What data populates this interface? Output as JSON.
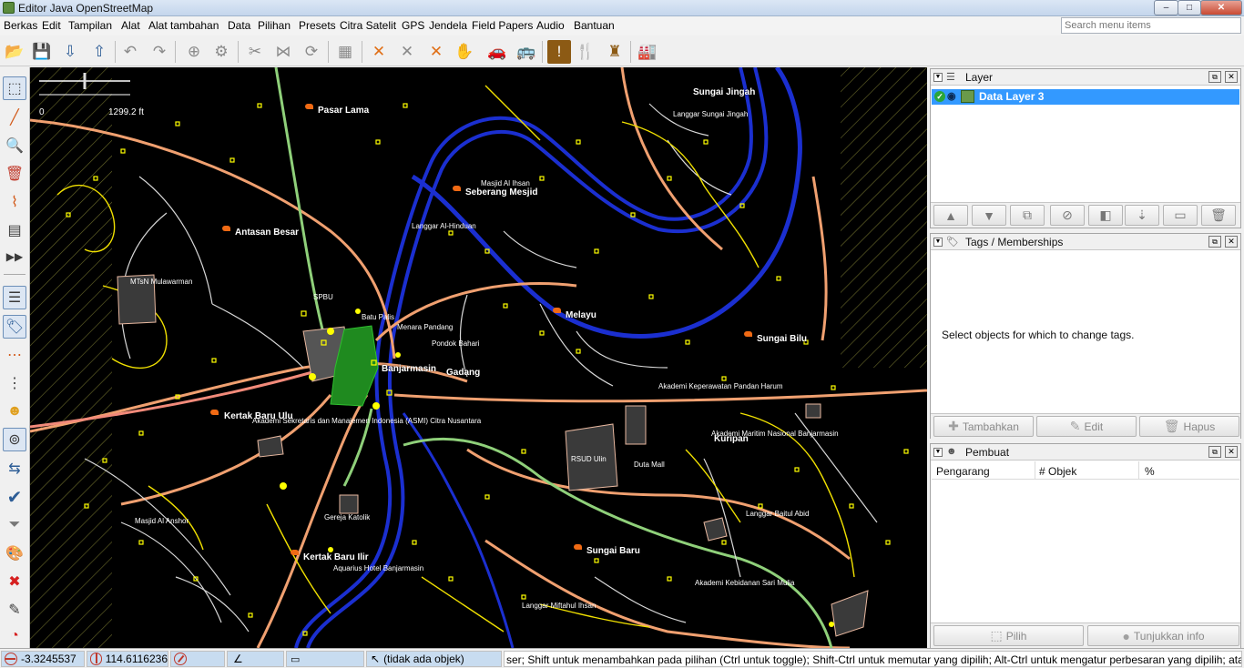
{
  "window": {
    "title": "Editor Java OpenStreetMap",
    "min": "–",
    "max": "□",
    "close": "✕"
  },
  "menu": {
    "items": [
      "Berkas",
      "Edit",
      "Tampilan",
      "Alat",
      "Alat tambahan",
      "Data",
      "Pilihan",
      "Presets",
      "Citra Satelit",
      "GPS",
      "Jendela",
      "Field Papers",
      "Audio",
      "Bantuan"
    ],
    "search_placeholder": "Search menu items"
  },
  "toolbar": {
    "icons": [
      "open-file-icon",
      "save-icon",
      "download-icon",
      "upload-icon",
      "undo-icon",
      "redo-icon",
      "zoom-to-data-icon",
      "preferences-icon",
      "split-way-icon",
      "combine-way-icon",
      "reverse-icon",
      "satellite-imagery-icon",
      "highway-icon",
      "highway-tertiary-icon",
      "highway-junction-icon",
      "barrier-hand-icon",
      "car-icon",
      "bus-icon",
      "amenity-icon",
      "restaurant-icon",
      "castle-icon",
      "industrial-icon"
    ]
  },
  "leftbar": {
    "icons": [
      "select-tool-icon",
      "draw-tool-icon",
      "zoom-tool-icon",
      "delete-tool-icon",
      "improve-way-icon",
      "parallel-way-icon",
      "more-tools-icon",
      "layers-toggle-icon",
      "tags-toggle-icon",
      "relations-toggle-icon",
      "selection-list-icon",
      "users-toggle-icon",
      "filter-toggle-icon",
      "conflict-toggle-icon",
      "validation-icon",
      "filter-icon",
      "map-paint-icon",
      "errors-icon",
      "history-icon",
      "speed-icon"
    ]
  },
  "map": {
    "scale": {
      "zero": "0",
      "max": "1299.2 ft"
    },
    "places": [
      {
        "name": "Pasar Lama",
        "kind": "place"
      },
      {
        "name": "Sungai Jingah",
        "kind": "place"
      },
      {
        "name": "Seberang Mesjid",
        "kind": "place"
      },
      {
        "name": "Antasan Besar",
        "kind": "place"
      },
      {
        "name": "Melayu",
        "kind": "place"
      },
      {
        "name": "Sungai Bilu",
        "kind": "place"
      },
      {
        "name": "Banjarmasin",
        "kind": "place"
      },
      {
        "name": "Gadang",
        "kind": "place"
      },
      {
        "name": "Kertak Baru Ulu",
        "kind": "place"
      },
      {
        "name": "Kuripan",
        "kind": "place"
      },
      {
        "name": "Kertak Baru Ilir",
        "kind": "place"
      },
      {
        "name": "Sungai Baru",
        "kind": "place"
      }
    ],
    "pois": [
      {
        "name": "Masjid Al Ihsan"
      },
      {
        "name": "Langgar Al-Hinduan"
      },
      {
        "name": "MTsN Mulawarman"
      },
      {
        "name": "SPBU"
      },
      {
        "name": "Batu Palis"
      },
      {
        "name": "Menara Pandang"
      },
      {
        "name": "Pondok Bahari"
      },
      {
        "name": "Akademi Keperawatan Pandan Harum"
      },
      {
        "name": "Akademi Sekretaris dan Manajemen Indonesia (ASMI) Citra Nusantara"
      },
      {
        "name": "RSUD Ulin"
      },
      {
        "name": "Duta Mall"
      },
      {
        "name": "Akademi Maritim Nasional Banjarmasin"
      },
      {
        "name": "Masjid Al Anshor"
      },
      {
        "name": "Gereja Katolik"
      },
      {
        "name": "Aquarius Hotel Banjarmasin"
      },
      {
        "name": "Langgar Baitul Abid"
      },
      {
        "name": "Akademi Kebidanan Sari Mulia"
      },
      {
        "name": "Langgar Miftahul Ihsan"
      },
      {
        "name": "Langgar Sungai Jingah"
      }
    ]
  },
  "panels": {
    "layers": {
      "title": "Layer",
      "active_layer": "Data Layer 3",
      "buttons": [
        "move-up-icon",
        "move-down-icon",
        "merge-icon",
        "delete-layer-icon",
        "opacity-icon",
        "duplicate-icon",
        "activate-icon",
        "trash-icon"
      ]
    },
    "tags": {
      "title": "Tags / Memberships",
      "message": "Select objects for which to change tags.",
      "add": "Tambahkan",
      "edit": "Edit",
      "delete": "Hapus"
    },
    "authors": {
      "title": "Pembuat",
      "columns": [
        "Pengarang",
        "# Objek",
        "%"
      ],
      "select": "Pilih",
      "show": "Tunjukkan info"
    }
  },
  "status": {
    "lat": "-3.3245537",
    "lon": "114.6116236",
    "object": "(tidak ada objek)",
    "help": "ser; Shift untuk menambahkan pada pilihan (Ctrl untuk toggle); Shift-Ctrl untuk memutar yang dipilih; Alt-Ctrl untuk mengatur perbesaran yang dipilih; atau ubah pilihan"
  },
  "colors": {
    "selection": "#3399ff",
    "river": "#1526c8",
    "road_orange": "#f0a070",
    "node_yellow": "#ffff00",
    "place_marker": "#f06a14"
  }
}
